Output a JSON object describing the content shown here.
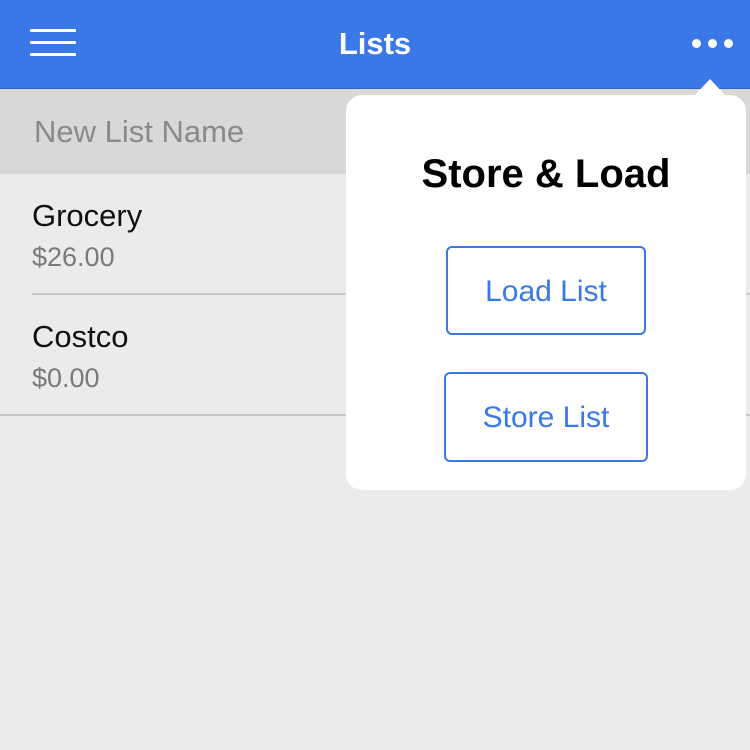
{
  "header": {
    "title": "Lists",
    "menu_icon": "hamburger-menu-icon",
    "more_icon": "more-horizontal-icon"
  },
  "new_list": {
    "placeholder": "New List Name",
    "value": ""
  },
  "lists": [
    {
      "name": "Grocery",
      "total": "$26.00"
    },
    {
      "name": "Costco",
      "total": "$0.00"
    }
  ],
  "popover": {
    "title": "Store & Load",
    "load_label": "Load List",
    "store_label": "Store List"
  },
  "colors": {
    "accent": "#3b78e7",
    "background": "#ebebeb",
    "input_background": "#d8d8d8"
  }
}
